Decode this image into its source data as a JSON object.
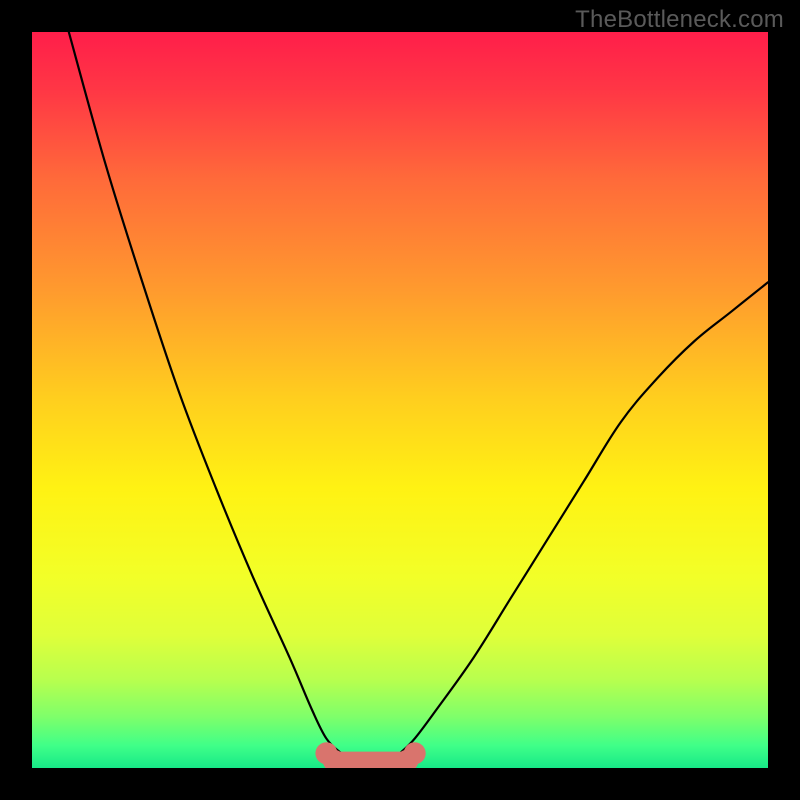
{
  "watermark": "TheBottleneck.com",
  "chart_data": {
    "type": "line",
    "title": "",
    "xlabel": "",
    "ylabel": "",
    "xlim": [
      0,
      100
    ],
    "ylim": [
      0,
      100
    ],
    "series": [
      {
        "name": "left-curve",
        "x": [
          5,
          10,
          15,
          20,
          25,
          30,
          35,
          38,
          40,
          42
        ],
        "values": [
          100,
          82,
          66,
          51,
          38,
          26,
          15,
          8,
          4,
          2
        ]
      },
      {
        "name": "right-curve",
        "x": [
          50,
          52,
          55,
          60,
          65,
          70,
          75,
          80,
          85,
          90,
          95,
          100
        ],
        "values": [
          2,
          4,
          8,
          15,
          23,
          31,
          39,
          47,
          53,
          58,
          62,
          66
        ]
      },
      {
        "name": "bottom-band",
        "x": [
          40,
          41,
          42,
          43,
          44,
          45,
          46,
          47,
          48,
          49,
          50,
          51,
          52
        ],
        "values": [
          2,
          1,
          1,
          1,
          1,
          1,
          1,
          1,
          1,
          1,
          1,
          1,
          2
        ]
      }
    ],
    "gradient_stops": [
      {
        "offset": 0.0,
        "color": "#ff1e4a"
      },
      {
        "offset": 0.08,
        "color": "#ff3745"
      },
      {
        "offset": 0.2,
        "color": "#ff6a3a"
      },
      {
        "offset": 0.35,
        "color": "#ff9a2e"
      },
      {
        "offset": 0.5,
        "color": "#ffcf1e"
      },
      {
        "offset": 0.62,
        "color": "#fff213"
      },
      {
        "offset": 0.74,
        "color": "#f2ff28"
      },
      {
        "offset": 0.82,
        "color": "#dfff3a"
      },
      {
        "offset": 0.88,
        "color": "#b8ff4e"
      },
      {
        "offset": 0.93,
        "color": "#7fff6a"
      },
      {
        "offset": 0.97,
        "color": "#3fff88"
      },
      {
        "offset": 1.0,
        "color": "#17e887"
      }
    ],
    "accent_color": "#d9746d",
    "curve_color": "#000000"
  }
}
